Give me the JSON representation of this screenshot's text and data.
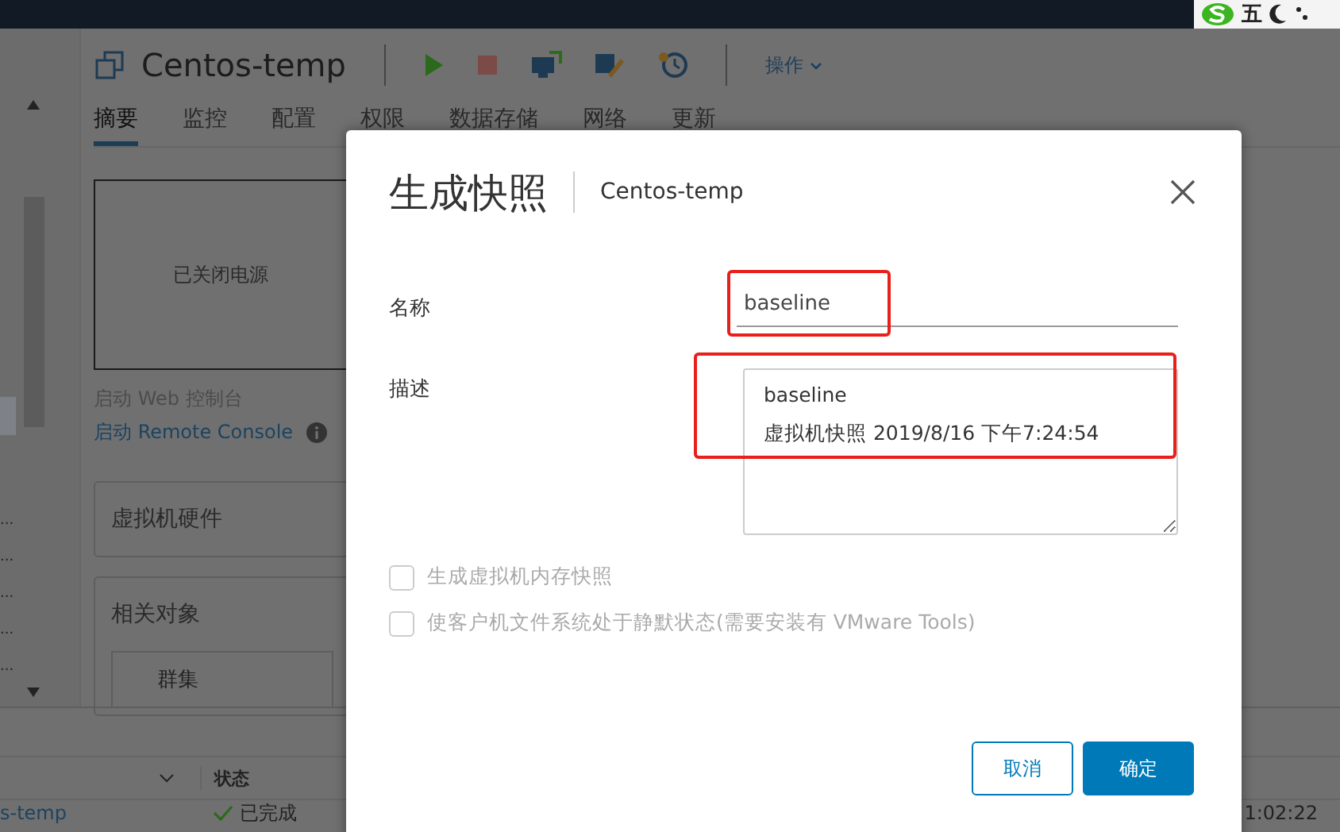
{
  "top_bar": {
    "ime_indicator": "五"
  },
  "nav_tree": {
    "items": [
      "...",
      "...",
      "...",
      "...",
      "..."
    ]
  },
  "header": {
    "title": "Centos-temp",
    "actions_menu": "操作"
  },
  "tabs": [
    {
      "label": "摘要",
      "selected": true
    },
    {
      "label": "监控",
      "selected": false
    },
    {
      "label": "配置",
      "selected": false
    },
    {
      "label": "权限",
      "selected": false
    },
    {
      "label": "数据存储",
      "selected": false
    },
    {
      "label": "网络",
      "selected": false
    },
    {
      "label": "更新",
      "selected": false
    }
  ],
  "summary": {
    "console_status": "已关闭电源",
    "web_console": "启动 Web 控制台",
    "remote_console": "启动 Remote Console"
  },
  "cards": [
    {
      "title": "虚拟机硬件"
    },
    {
      "title": "相关对象",
      "rows": [
        "群集"
      ]
    }
  ],
  "tasks_table": {
    "columns": [
      "状态"
    ],
    "rows": [
      {
        "name": "s-temp",
        "status": "已完成",
        "time": "1:02:22"
      }
    ]
  },
  "dialog": {
    "title": "生成快照",
    "subtitle": "Centos-temp",
    "fields": [
      {
        "label": "名称",
        "kind": "input",
        "value": "baseline"
      },
      {
        "label": "描述",
        "kind": "textarea",
        "lines": [
          "baseline",
          "虚拟机快照 2019/8/16 下午7:24:54"
        ]
      }
    ],
    "options": [
      {
        "label": "生成虚拟机内存快照",
        "checked": false,
        "disabled": true
      },
      {
        "label": "使客户机文件系统处于静默状态(需要安装有 VMware Tools)",
        "checked": false,
        "disabled": true
      }
    ],
    "buttons": [
      {
        "label": "取消",
        "kind": "secondary"
      },
      {
        "label": "确定",
        "kind": "primary"
      }
    ]
  }
}
